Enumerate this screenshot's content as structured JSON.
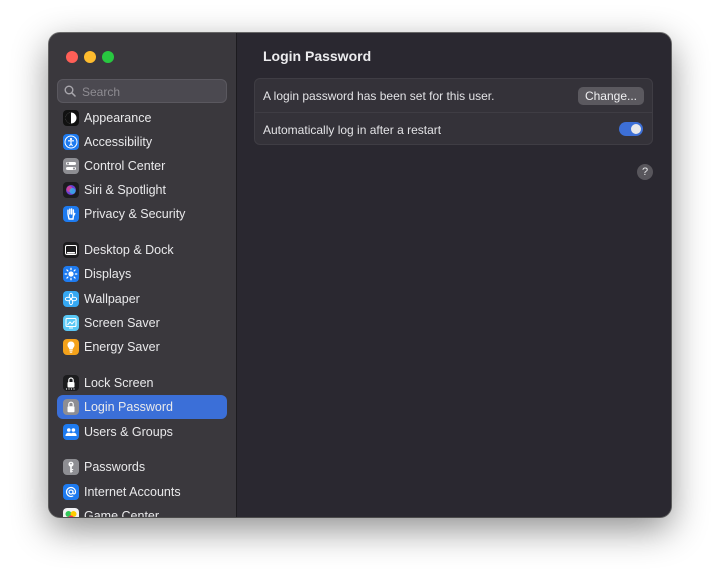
{
  "window": {
    "title": "Login Password"
  },
  "search": {
    "placeholder": "Search"
  },
  "sidebar": {
    "items": [
      {
        "label": "Appearance",
        "icon": "appearance-icon"
      },
      {
        "label": "Accessibility",
        "icon": "accessibility-icon"
      },
      {
        "label": "Control Center",
        "icon": "control-center-icon"
      },
      {
        "label": "Siri & Spotlight",
        "icon": "siri-icon"
      },
      {
        "label": "Privacy & Security",
        "icon": "hand-icon"
      },
      {
        "label": "Desktop & Dock",
        "icon": "desktop-dock-icon"
      },
      {
        "label": "Displays",
        "icon": "displays-icon"
      },
      {
        "label": "Wallpaper",
        "icon": "wallpaper-icon"
      },
      {
        "label": "Screen Saver",
        "icon": "screen-saver-icon"
      },
      {
        "label": "Energy Saver",
        "icon": "energy-saver-icon"
      },
      {
        "label": "Lock Screen",
        "icon": "lock-screen-icon"
      },
      {
        "label": "Login Password",
        "icon": "lock-icon",
        "selected": true
      },
      {
        "label": "Users & Groups",
        "icon": "users-icon"
      },
      {
        "label": "Passwords",
        "icon": "key-icon"
      },
      {
        "label": "Internet Accounts",
        "icon": "at-icon"
      },
      {
        "label": "Game Center",
        "icon": "game-center-icon"
      }
    ]
  },
  "main": {
    "title": "Login Password",
    "rows": [
      {
        "label": "A login password has been set for this user.",
        "button_label": "Change..."
      },
      {
        "label": "Automatically log in after a restart",
        "toggle_on": true
      }
    ],
    "help_label": "?"
  },
  "colors": {
    "accent": "#3b6fd8",
    "sidebar_bg": "#3a383d",
    "content_bg": "#2a2830"
  }
}
